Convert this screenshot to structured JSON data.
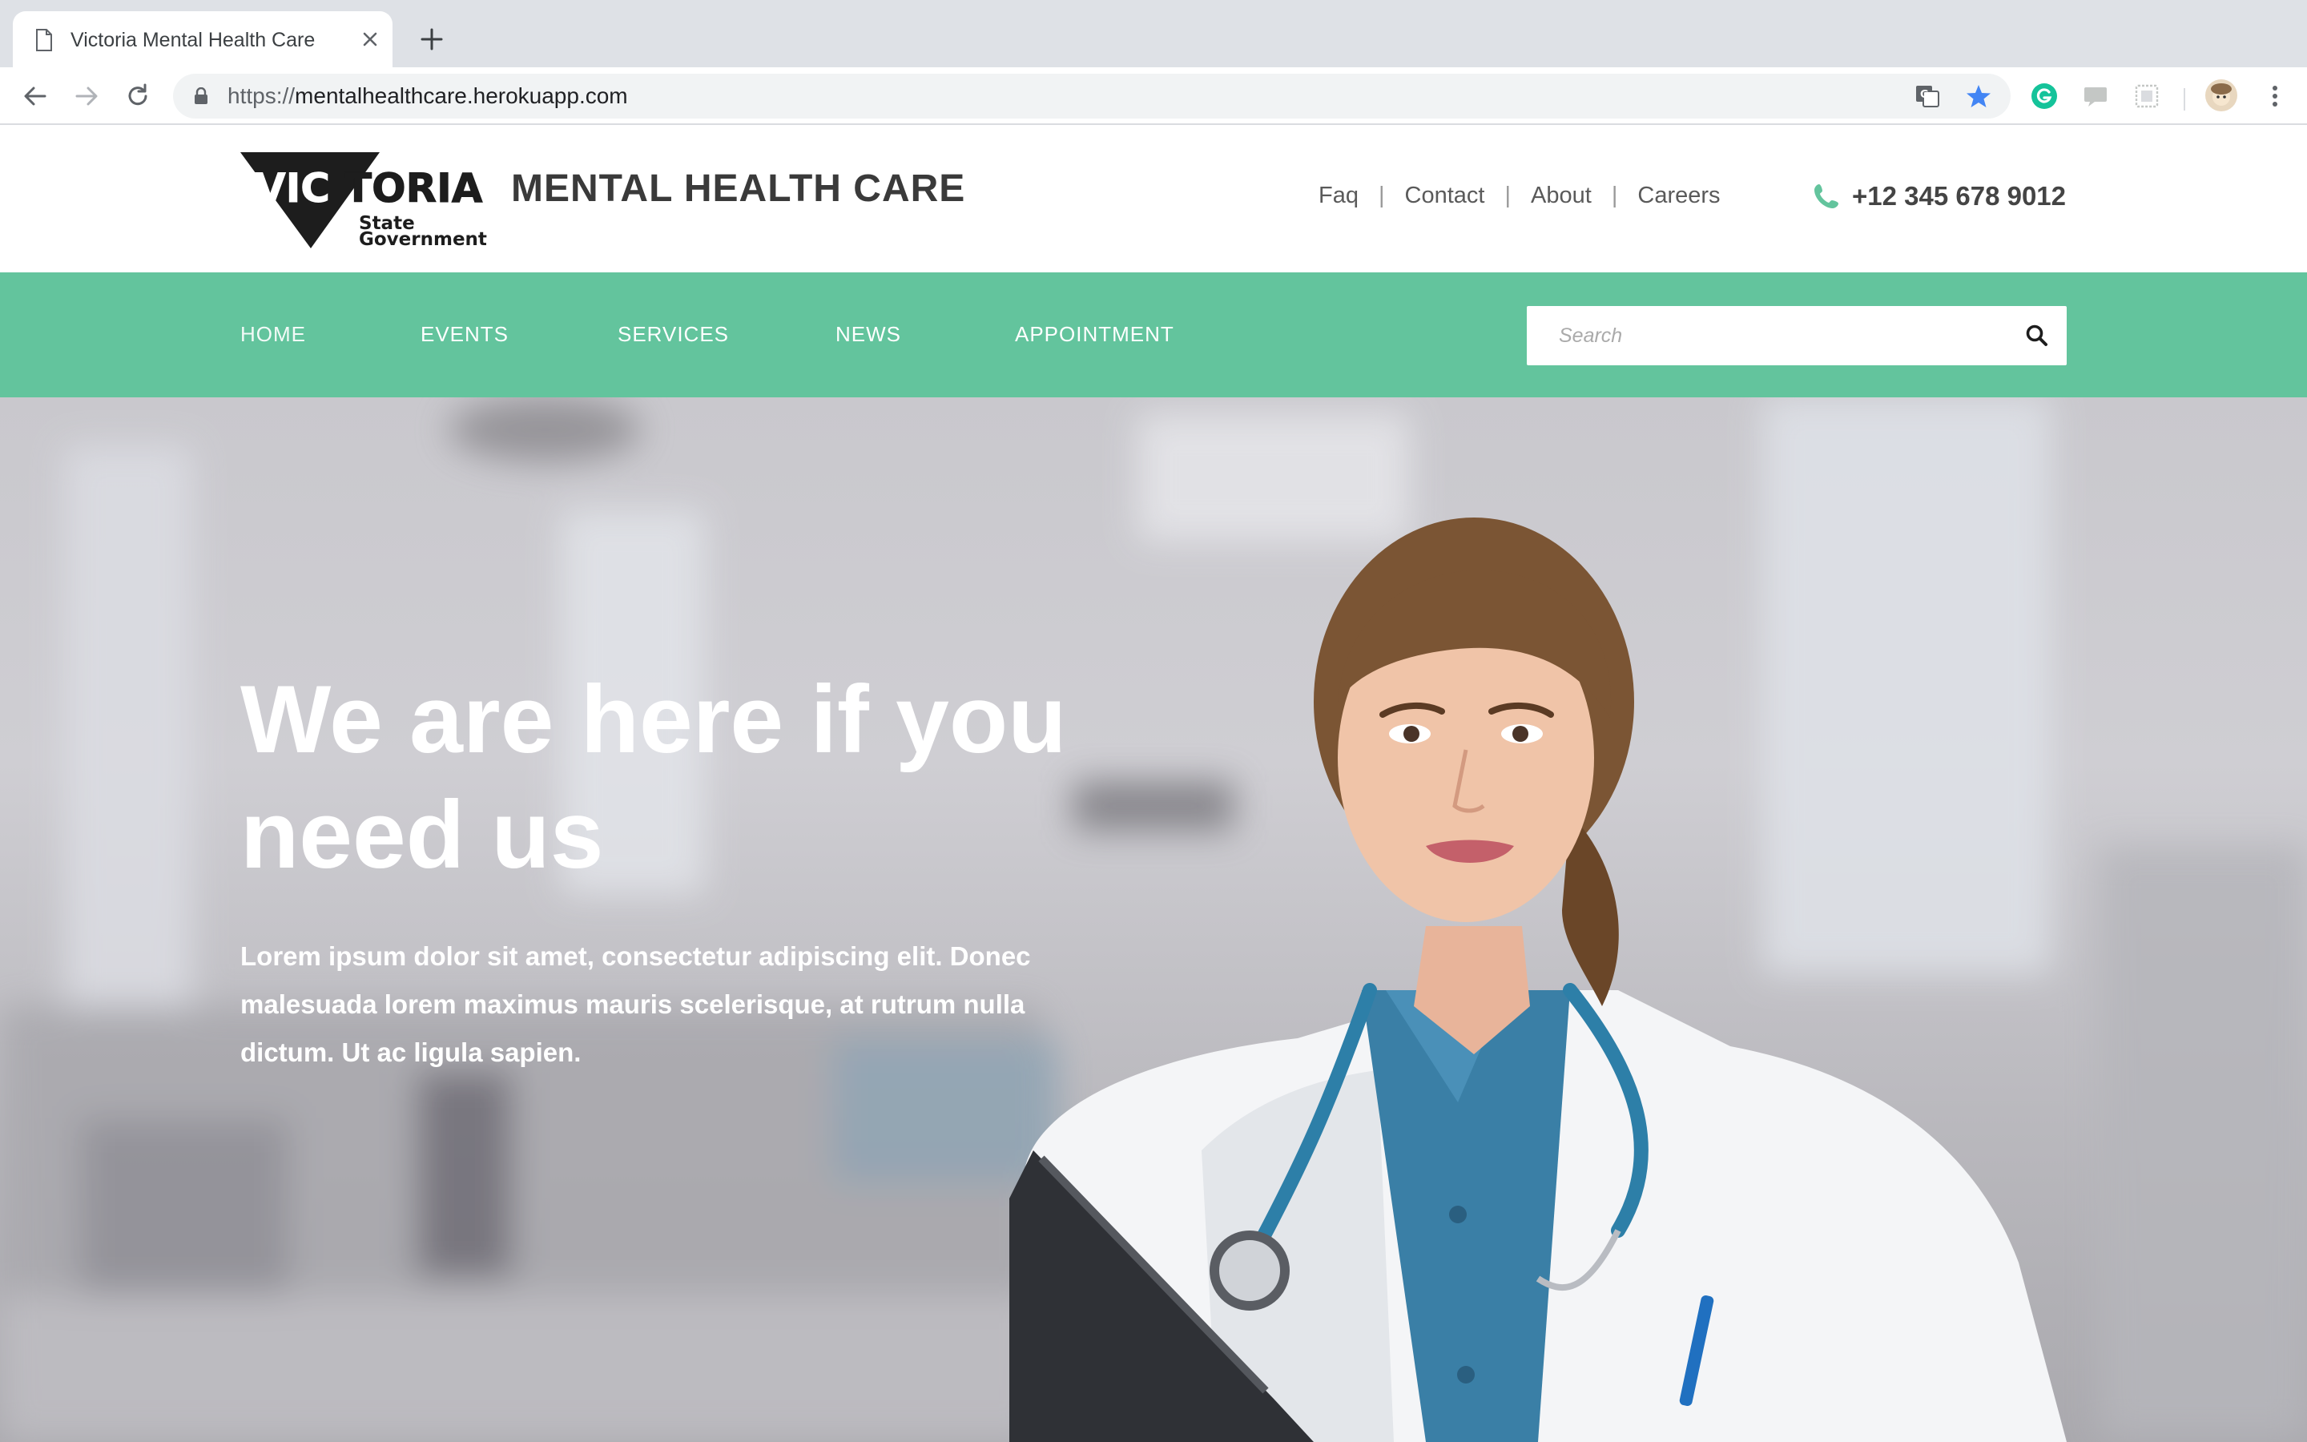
{
  "browser": {
    "tab_title": "Victoria Mental Health Care",
    "url_scheme": "https://",
    "url_host": "mentalhealthcare.herokuapp.com"
  },
  "header": {
    "logo_word": "VICTORIA",
    "logo_sub_line1": "State",
    "logo_sub_line2": "Government",
    "brand_title": "MENTAL HEALTH CARE",
    "top_links": [
      "Faq",
      "Contact",
      "About",
      "Careers"
    ],
    "separator": "|",
    "phone": "+12 345 678 9012"
  },
  "nav": {
    "items": [
      "HOME",
      "EVENTS",
      "SERVICES",
      "NEWS",
      "APPOINTMENT"
    ],
    "search_placeholder": "Search"
  },
  "hero": {
    "title": "We are here if you need us",
    "text": "Lorem ipsum dolor sit amet, consectetur adipiscing elit. Donec malesuada lorem maximus mauris scelerisque, at rutrum nulla dictum. Ut ac ligula sapien."
  },
  "colors": {
    "brand_green": "#63c49d",
    "chrome_bg": "#dee1e6",
    "heading_dark": "#3a3a3a"
  },
  "icons": [
    "page-icon",
    "close-icon",
    "plus-icon",
    "back-icon",
    "forward-icon",
    "reload-icon",
    "lock-icon",
    "translate-icon",
    "star-icon",
    "grammarly-icon",
    "cast-icon",
    "extension-icon",
    "profile-avatar",
    "menu-icon",
    "phone-icon",
    "search-icon"
  ]
}
